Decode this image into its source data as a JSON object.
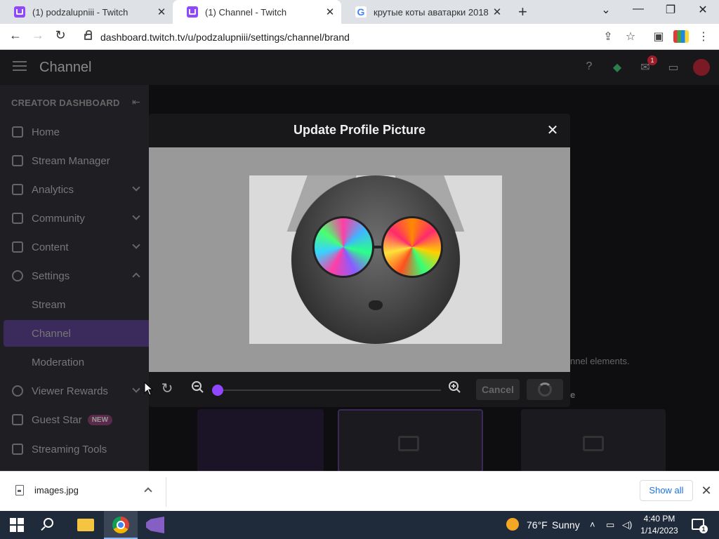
{
  "browser": {
    "tabs": [
      {
        "title": "(1) podzalupniii - Twitch",
        "active": false
      },
      {
        "title": "(1) Channel - Twitch",
        "active": true
      },
      {
        "title": "крутые коты аватарки 2018 - Go",
        "active": false
      }
    ],
    "new_tab": "+",
    "url": "dashboard.twitch.tv/u/podzalupniii/settings/channel/brand"
  },
  "twitch": {
    "page_title": "Channel",
    "notification_count": "1",
    "sidebar": {
      "header": "CREATOR DASHBOARD",
      "items": [
        {
          "label": "Home"
        },
        {
          "label": "Stream Manager"
        },
        {
          "label": "Analytics"
        },
        {
          "label": "Community"
        },
        {
          "label": "Content"
        },
        {
          "label": "Settings"
        },
        {
          "label": "Stream"
        },
        {
          "label": "Channel"
        },
        {
          "label": "Moderation"
        },
        {
          "label": "Viewer Rewards"
        },
        {
          "label": "Guest Star",
          "badge": "NEW"
        },
        {
          "label": "Streaming Tools"
        }
      ]
    },
    "background_text": {
      "line1": "nnel elements.",
      "line2": "e"
    }
  },
  "modal": {
    "title": "Update Profile Picture",
    "cancel_label": "Cancel",
    "zoom_level": 0.0
  },
  "downloads": {
    "file_name": "images.jpg",
    "show_all_label": "Show all"
  },
  "taskbar": {
    "weather_temp": "76°F",
    "weather_desc": "Sunny",
    "time": "4:40 PM",
    "date": "1/14/2023",
    "notification_count": "1"
  },
  "colors": {
    "twitch_purple": "#9147ff",
    "modal_bg": "#18181b",
    "crop_bg": "#999999"
  }
}
